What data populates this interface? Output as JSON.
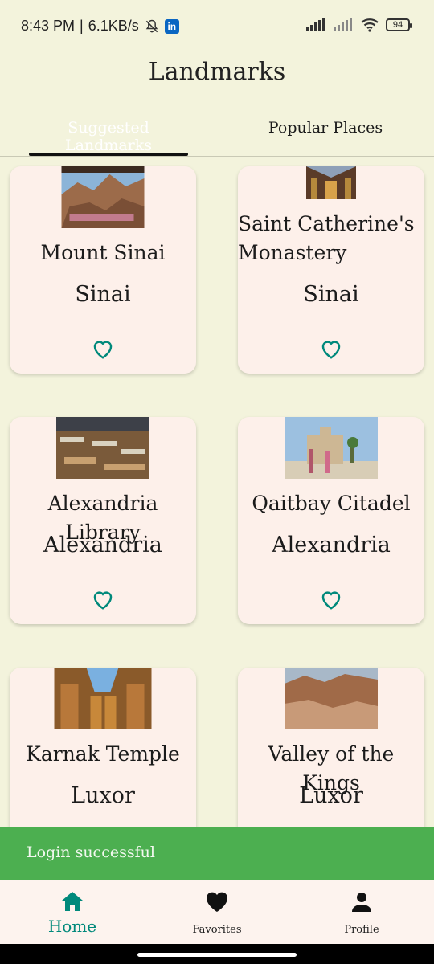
{
  "status_bar": {
    "time": "8:43 PM",
    "separator": "|",
    "speed": "6.1KB/s",
    "linkedin_badge": "in",
    "battery": "94",
    "icons": [
      "bell-off-icon",
      "linkedin-icon",
      "signal-icon",
      "signal-icon",
      "wifi-icon",
      "battery-icon"
    ]
  },
  "header": {
    "title": "Landmarks"
  },
  "tabs": [
    {
      "label": "Suggested Landmarks",
      "selected": true
    },
    {
      "label": "Popular Places",
      "selected": false
    }
  ],
  "landmarks": [
    {
      "name": "Mount Sinai",
      "region": "Sinai",
      "favorite_icon": "heart-outline-icon"
    },
    {
      "name": "Saint Catherine's Monastery",
      "region": "Sinai",
      "favorite_icon": "heart-outline-icon"
    },
    {
      "name": "Alexandria Library",
      "region": "Alexandria",
      "favorite_icon": "heart-outline-icon"
    },
    {
      "name": "Qaitbay Citadel",
      "region": "Alexandria",
      "favorite_icon": "heart-outline-icon"
    },
    {
      "name": "Karnak Temple",
      "region": "Luxor",
      "favorite_icon": "heart-outline-icon"
    },
    {
      "name": "Valley of the Kings",
      "region": "Luxor",
      "favorite_icon": "heart-outline-icon"
    }
  ],
  "snackbar": {
    "message": "Login successful",
    "color": "#4caf50"
  },
  "bottom_nav": [
    {
      "label": "Home",
      "icon": "home-icon",
      "active": true
    },
    {
      "label": "Favorites",
      "icon": "heart-icon",
      "active": false
    },
    {
      "label": "Profile",
      "icon": "person-icon",
      "active": false
    }
  ],
  "colors": {
    "accent": "#00897b",
    "background": "#f3f3dc",
    "card": "#fdf0ea"
  }
}
